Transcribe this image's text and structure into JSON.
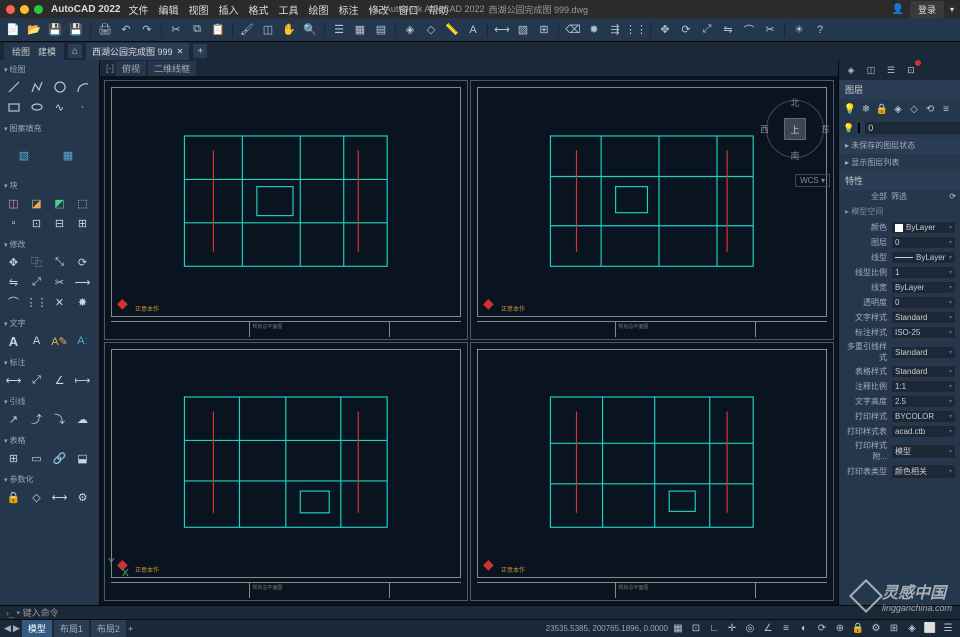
{
  "app": {
    "name": "AutoCAD 2022",
    "title_center": "Autodesk AutoCAD 2022",
    "doc": "西湖公园完成图 999.dwg",
    "login": "登录"
  },
  "menu": [
    "文件",
    "编辑",
    "视图",
    "插入",
    "格式",
    "工具",
    "绘图",
    "标注",
    "修改",
    "窗口",
    "帮助"
  ],
  "doctabs": {
    "bigA": "绘图",
    "bigB": "建模",
    "small": "西湖公园完成图 999"
  },
  "canvastabs": [
    "俯视",
    "二维线框"
  ],
  "left": {
    "sec1": "绘图",
    "sec2": "图案填充",
    "sec3": "块",
    "sec4": "修改",
    "sec5": "文字",
    "sec6": "标注",
    "sec7": "引线",
    "sec8": "表格",
    "sec9": "参数化"
  },
  "compass": {
    "n": "北",
    "s": "南",
    "e": "东",
    "w": "西",
    "face": "上",
    "wcs": "WCS"
  },
  "right": {
    "h1": "图层",
    "layer_val": "0",
    "unsaved": "未保存的图层状态",
    "listmsg": "显示图层列表",
    "h2": "特性",
    "filter": "全部",
    "filterB": "筛选",
    "space": "模型空间",
    "props": [
      {
        "lbl": "颜色",
        "val": "ByLayer",
        "swatch": true
      },
      {
        "lbl": "图层",
        "val": "0"
      },
      {
        "lbl": "线型",
        "val": "ByLayer",
        "line": true
      },
      {
        "lbl": "线型比例",
        "val": "1"
      },
      {
        "lbl": "线宽",
        "val": "ByLayer"
      },
      {
        "lbl": "透明度",
        "val": "0"
      },
      {
        "lbl": "文字样式",
        "val": "Standard"
      },
      {
        "lbl": "标注样式",
        "val": "ISO-25"
      },
      {
        "lbl": "多重引线样式",
        "val": "Standard"
      },
      {
        "lbl": "表格样式",
        "val": "Standard"
      },
      {
        "lbl": "注释比例",
        "val": "1:1"
      },
      {
        "lbl": "文字高度",
        "val": "2.5"
      },
      {
        "lbl": "打印样式",
        "val": "BYCOLOR"
      },
      {
        "lbl": "打印样式表",
        "val": "acad.ctb"
      },
      {
        "lbl": "打印样式附...",
        "val": "模型"
      },
      {
        "lbl": "打印表类型",
        "val": "颜色相关"
      }
    ]
  },
  "cmd": {
    "prompt": "键入命令"
  },
  "status": {
    "tabs": [
      "模型",
      "布局1",
      "布局2"
    ],
    "coord": "23535.5385, 200765.1896, 0.0000"
  },
  "sheet": {
    "stamp_txt": "正意本作",
    "title": "规划总平面图"
  },
  "watermark": {
    "main": "灵感中国",
    "sub": "lingganchina.com"
  }
}
